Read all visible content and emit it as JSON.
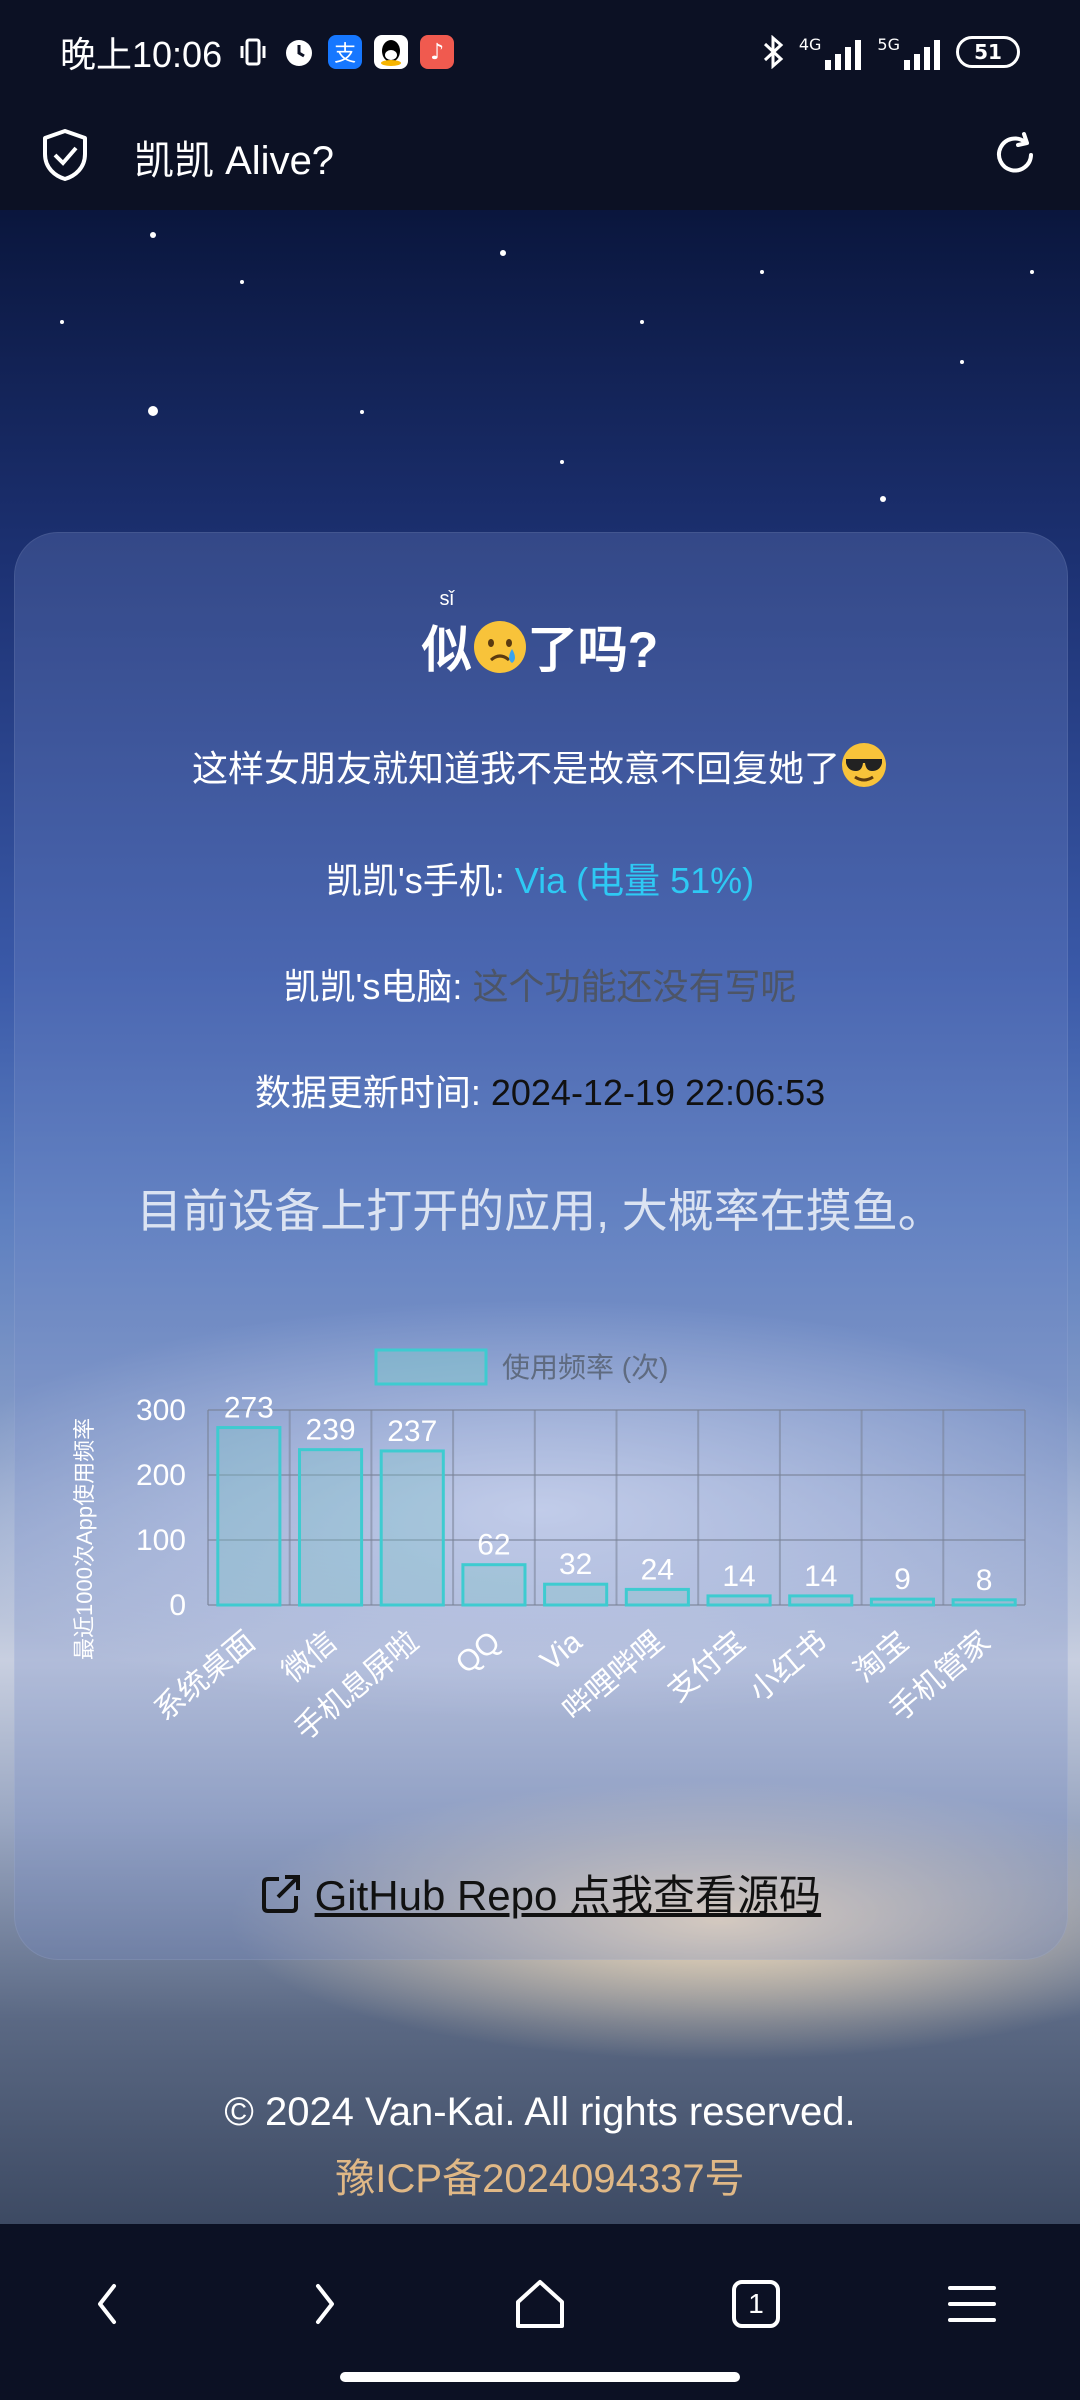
{
  "status": {
    "time": "晚上10:06",
    "battery": "51",
    "net1": "4G",
    "net2": "5G"
  },
  "app_bar": {
    "title": "凯凯 Alive?"
  },
  "card": {
    "heading_pre": "似",
    "heading_pinyin": "sǐ",
    "heading_post": "了吗?",
    "tagline": "这样女朋友就知道我不是故意不回复她了",
    "phone_label": "凯凯's手机: ",
    "phone_value": "Via (电量 51%)",
    "pc_label": "凯凯's电脑: ",
    "pc_value": "这个功能还没有写呢",
    "update_label": "数据更新时间: ",
    "update_value": "2024-12-19 22:06:53",
    "apps_heading": "目前设备上打开的应用, 大概率在摸鱼。",
    "repo_link": "GitHub Repo 点我查看源码"
  },
  "chart_data": {
    "type": "bar",
    "categories": [
      "系统桌面",
      "微信",
      "手机息屏啦",
      "QQ",
      "Via",
      "哔哩哔哩",
      "支付宝",
      "小红书",
      "淘宝",
      "手机管家"
    ],
    "series": [
      {
        "name": "使用频率 (次)",
        "values": [
          273,
          239,
          237,
          62,
          32,
          24,
          14,
          14,
          9,
          8
        ]
      }
    ],
    "ylabel": "最近1000次App使用频率",
    "y_ticks": [
      "0",
      "100",
      "200",
      "300"
    ],
    "ylim": [
      0,
      300
    ],
    "legend_position": "top",
    "colors": {
      "bar_fill": "#7dc3c8",
      "bar_stroke": "#3ecbd0"
    }
  },
  "footer": {
    "copyright": "© 2024 Van-Kai. All rights reserved.",
    "icp": "豫ICP备2024094337号"
  },
  "nav": {
    "tabs_count": "1"
  }
}
